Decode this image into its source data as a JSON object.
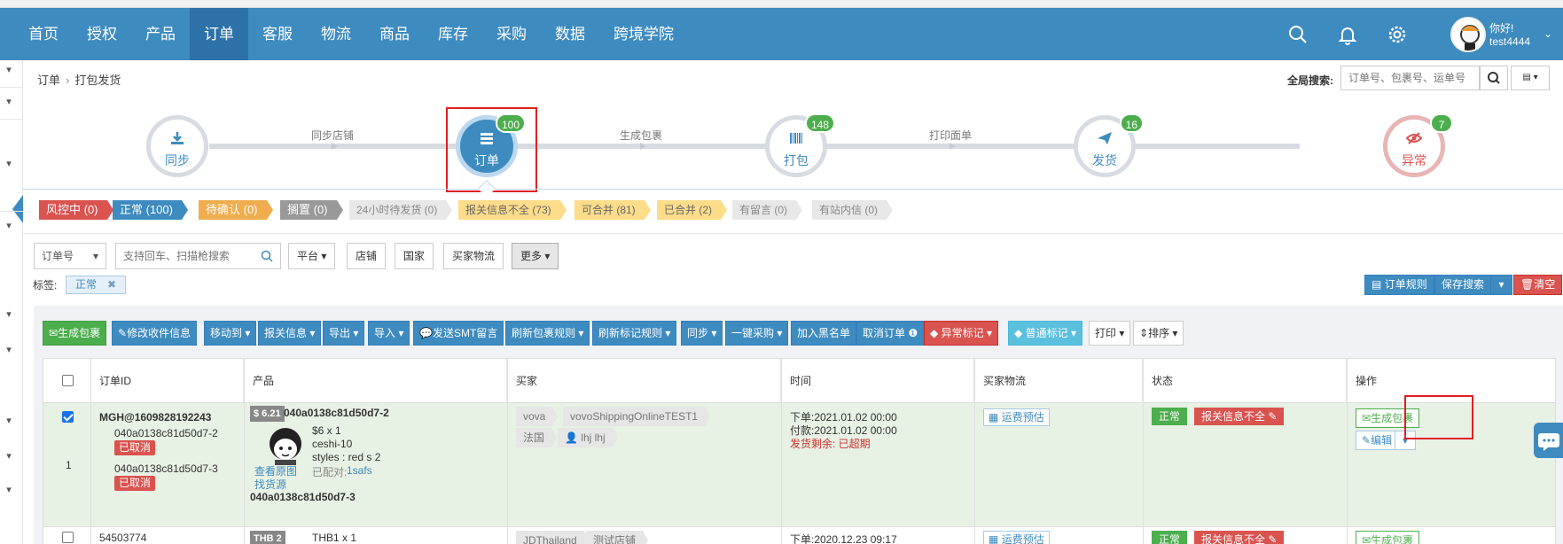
{
  "nav": {
    "items": [
      "首页",
      "授权",
      "产品",
      "订单",
      "客服",
      "物流",
      "商品",
      "库存",
      "采购",
      "数据",
      "跨境学院"
    ],
    "active_index": 3,
    "user_greeting": "你好!",
    "user_name": "test4444"
  },
  "breadcrumb": {
    "root": "订单",
    "current": "打包发货"
  },
  "global_search": {
    "label": "全局搜索:",
    "placeholder": "订单号、包裹号、运单号"
  },
  "workflow": {
    "nodes": [
      {
        "label": "同步",
        "badge": ""
      },
      {
        "label": "订单",
        "badge": "100"
      },
      {
        "label": "打包",
        "badge": "148"
      },
      {
        "label": "发货",
        "badge": "16"
      },
      {
        "label": "异常",
        "badge": "7"
      }
    ],
    "steps": [
      "同步店铺",
      "生成包裹",
      "打印面单"
    ]
  },
  "status_tags": [
    "风控中 (0)",
    "正常 (100)",
    "待确认 (0)",
    "搁置 (0)",
    "24小时待发货 (0)",
    "报关信息不全 (73)",
    "可合并 (81)",
    "已合并 (2)",
    "有留言 (0)",
    "有站内信 (0)"
  ],
  "filters": {
    "order_select": "订单号",
    "search_placeholder": "支持回车、扫描枪搜索",
    "platform": "平台",
    "shop": "店铺",
    "country": "国家",
    "buyer_logistics": "买家物流",
    "more": "更多",
    "label_title": "标签:",
    "label_chip": "正常",
    "order_rules": "订单规则",
    "save_search": "保存搜索",
    "clear": "清空"
  },
  "toolbar": [
    "生成包裹",
    "修改收件信息",
    "移动到",
    "报关信息",
    "导出",
    "导入",
    "发送SMT留言",
    "刷新包裹规则",
    "刷新标记规则",
    "同步",
    "一键采购",
    "加入黑名单",
    "取消订单",
    "异常标记",
    "普通标记",
    "打印",
    "排序"
  ],
  "table": {
    "headers": [
      "订单ID",
      "产品",
      "买家",
      "时间",
      "买家物流",
      "状态",
      "操作"
    ],
    "row1": {
      "order_id": "MGH@1609828192243",
      "sub1": "040a0138c81d50d7-2",
      "sub1_status": "已取消",
      "sub2": "040a0138c81d50d7-3",
      "sub2_status": "已取消",
      "row_index": "1",
      "price_tag": "$ 6.21",
      "product_id": "040a0138c81d50d7-2",
      "price_qty": "$6 x 1",
      "sku": "ceshi-10",
      "styles": "styles : red s 2",
      "matched_label": "已配对:",
      "matched_value": "1safs",
      "view_image": "查看原图",
      "find_source": "找货源",
      "product_id2": "040a0138c81d50d7-3",
      "platform": "vova",
      "shop": "vovoShippingOnlineTEST1",
      "country": "法国",
      "buyer": "lhj lhj",
      "order_time": "下单:2021.01.02 00:00",
      "pay_time": "付款:2021.01.02 00:00",
      "ship_left": "发货剩余: 已超期",
      "freight": "运费预估",
      "status_normal": "正常",
      "status_customs": "报关信息不全",
      "op_generate": "生成包裹",
      "op_edit": "编辑"
    },
    "row2": {
      "order_id": "54503774",
      "price_tag": "THB 2",
      "price_qty": "THB1 x 1",
      "platform": "JDThailand",
      "shop": "测试店铺",
      "order_time": "下单:2020.12.23 09:17",
      "freight": "运费预估",
      "status_normal": "正常",
      "status_customs": "报关信息不全",
      "op_generate": "生成包裹"
    }
  }
}
